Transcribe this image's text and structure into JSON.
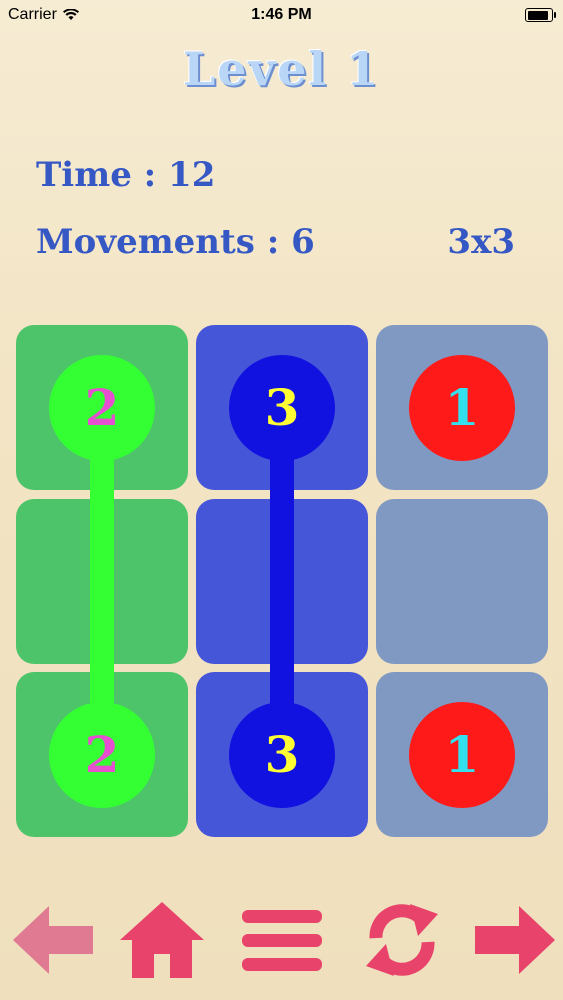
{
  "status_bar": {
    "carrier": "Carrier",
    "time": "1:46 PM"
  },
  "header": {
    "level": "Level 1"
  },
  "stats": {
    "time": "Time : 12",
    "movements": "Movements : 6",
    "grid_size": "3x3"
  },
  "board": {
    "rows": 3,
    "cols": 3,
    "column_colors": [
      "#4dc46a",
      "#4656d9",
      "#7f99c2"
    ],
    "pairs": [
      {
        "number": "2",
        "color": "#33ff33",
        "text_color": "#e64fd0",
        "column": 0
      },
      {
        "number": "3",
        "color": "#1111e0",
        "text_color": "#ffff33",
        "column": 1
      },
      {
        "number": "1",
        "color": "#ff1a1a",
        "text_color": "#33e0ee",
        "column": 2
      }
    ]
  },
  "toolbar": {
    "accent": "#e8436a",
    "buttons": [
      "back-arrow-icon",
      "home-icon",
      "menu-icon",
      "refresh-icon",
      "forward-arrow-icon"
    ]
  }
}
